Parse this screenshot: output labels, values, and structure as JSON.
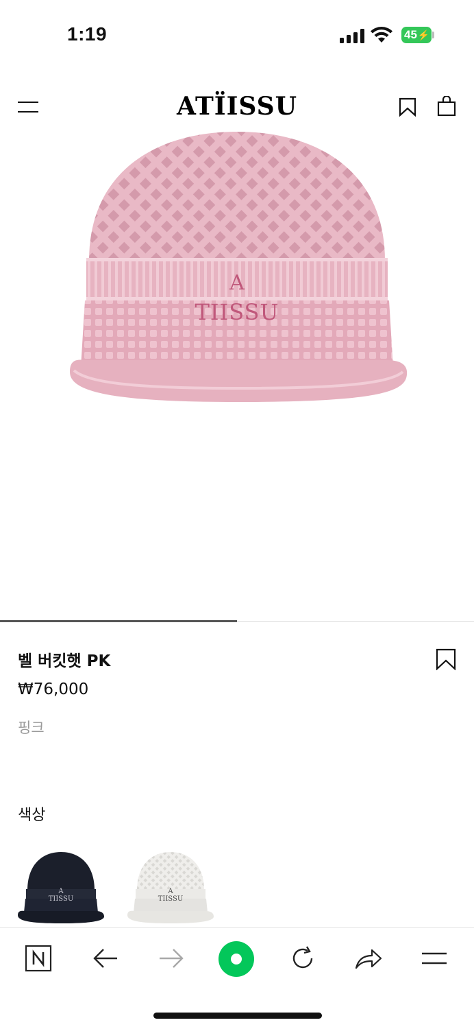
{
  "status_bar": {
    "time": "1:19",
    "battery_level": "45",
    "signal_bars": 4
  },
  "header": {
    "logo": "ATÏISSU",
    "menu_icon": "hamburger-icon",
    "bookmark_icon": "bookmark-icon",
    "bag_icon": "shopping-bag-icon"
  },
  "hero": {
    "embroidered_text_line1": "A",
    "embroidered_text_line2": "TIISSU",
    "hat_color": "#e8b7c4",
    "carousel_progress": 0.5
  },
  "product": {
    "name": "벨 버킷햇 PK",
    "price": "₩76,000",
    "color_name": "핑크"
  },
  "color_section": {
    "heading": "색상",
    "swatches": [
      {
        "id": "navy",
        "label_line1": "A",
        "label_line2": "TIISSU",
        "color": "#1d2230"
      },
      {
        "id": "white",
        "label_line1": "A",
        "label_line2": "TIISSU",
        "color": "#ecebe8"
      }
    ]
  },
  "bottom_nav": {
    "items": [
      "naver-n-icon",
      "back-arrow-icon",
      "forward-arrow-icon",
      "green-dot-icon",
      "reload-icon",
      "share-icon",
      "menu-lines-icon"
    ],
    "accent": "#03c75a"
  }
}
